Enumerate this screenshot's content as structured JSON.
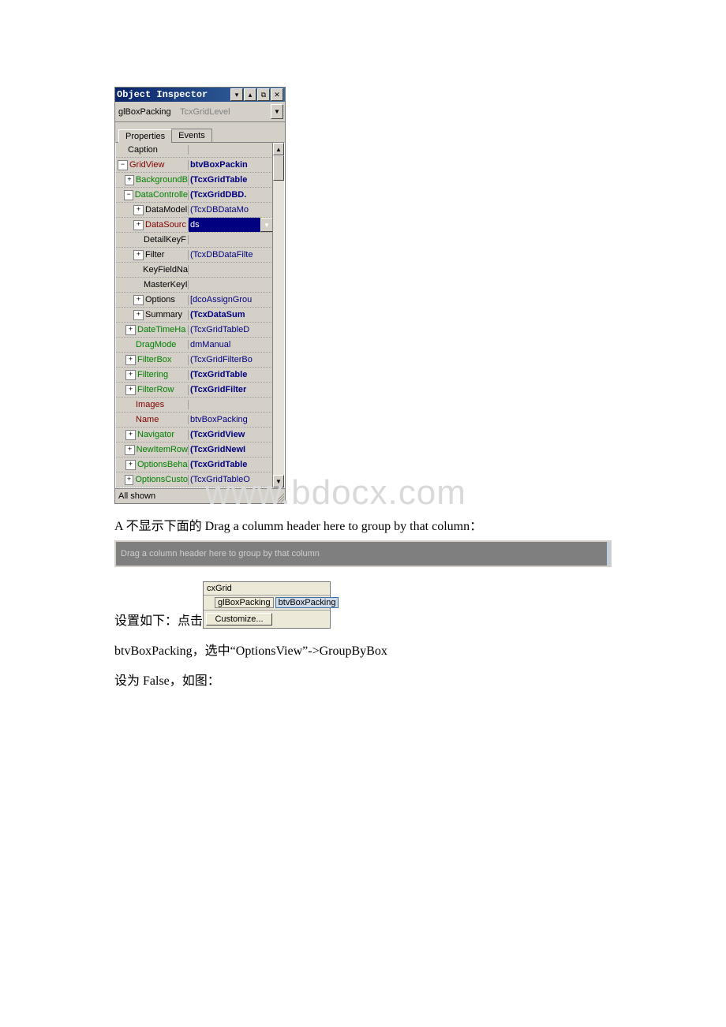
{
  "inspector": {
    "title": "Object Inspector",
    "combo": {
      "name": "glBoxPacking",
      "type": "TcxGridLevel"
    },
    "tabs": {
      "properties": "Properties",
      "events": "Events"
    },
    "rows": [
      {
        "indent": 0,
        "icon": "",
        "name": "Caption",
        "ncol": "black",
        "val": ""
      },
      {
        "indent": 0,
        "icon": "−",
        "name": "GridView",
        "ncol": "maroon",
        "val": "btvBoxPackin",
        "vcol": "navy"
      },
      {
        "indent": 1,
        "icon": "+",
        "name": "BackgroundB",
        "ncol": "green",
        "val": "(TcxGridTable",
        "vcol": "navy"
      },
      {
        "indent": 1,
        "icon": "−",
        "name": "DataControlle",
        "ncol": "green",
        "val": "(TcxGridDBD.",
        "vcol": "navy"
      },
      {
        "indent": 2,
        "icon": "+",
        "name": "DataModel",
        "ncol": "black",
        "val": "(TcxDBDataMo",
        "vcol": "navyn"
      },
      {
        "indent": 2,
        "icon": "+",
        "name": "DataSourc",
        "ncol": "maroon",
        "val": "ds",
        "vcol": "sel",
        "selected": true
      },
      {
        "indent": 2,
        "icon": "",
        "name": "DetailKeyF",
        "ncol": "black",
        "val": ""
      },
      {
        "indent": 2,
        "icon": "+",
        "name": "Filter",
        "ncol": "black",
        "val": "(TcxDBDataFilte",
        "vcol": "navyn"
      },
      {
        "indent": 2,
        "icon": "",
        "name": "KeyFieldNa",
        "ncol": "black",
        "val": ""
      },
      {
        "indent": 2,
        "icon": "",
        "name": "MasterKeyI",
        "ncol": "black",
        "val": ""
      },
      {
        "indent": 2,
        "icon": "+",
        "name": "Options",
        "ncol": "black",
        "val": "[dcoAssignGrou",
        "vcol": "navyn"
      },
      {
        "indent": 2,
        "icon": "+",
        "name": "Summary",
        "ncol": "black",
        "val": "(TcxDataSum",
        "vcol": "navy"
      },
      {
        "indent": 1,
        "icon": "+",
        "name": "DateTimeHa",
        "ncol": "green",
        "val": "(TcxGridTableD",
        "vcol": "navyn"
      },
      {
        "indent": 1,
        "icon": "",
        "name": "DragMode",
        "ncol": "green",
        "val": "dmManual",
        "vcol": "navyn"
      },
      {
        "indent": 1,
        "icon": "+",
        "name": "FilterBox",
        "ncol": "green",
        "val": "(TcxGridFilterBo",
        "vcol": "navyn"
      },
      {
        "indent": 1,
        "icon": "+",
        "name": "Filtering",
        "ncol": "green",
        "val": "(TcxGridTable",
        "vcol": "navy"
      },
      {
        "indent": 1,
        "icon": "+",
        "name": "FilterRow",
        "ncol": "green",
        "val": "(TcxGridFilter",
        "vcol": "navy"
      },
      {
        "indent": 1,
        "icon": "",
        "name": "Images",
        "ncol": "maroon",
        "val": ""
      },
      {
        "indent": 1,
        "icon": "",
        "name": "Name",
        "ncol": "maroon",
        "val": "btvBoxPacking",
        "vcol": "navyn"
      },
      {
        "indent": 1,
        "icon": "+",
        "name": "Navigator",
        "ncol": "green",
        "val": "(TcxGridView",
        "vcol": "navy"
      },
      {
        "indent": 1,
        "icon": "+",
        "name": "NewItemRow",
        "ncol": "green",
        "val": "(TcxGridNewI",
        "vcol": "navy"
      },
      {
        "indent": 1,
        "icon": "+",
        "name": "OptionsBeha",
        "ncol": "green",
        "val": "(TcxGridTable",
        "vcol": "navy"
      },
      {
        "indent": 1,
        "icon": "+",
        "name": "OptionsCusto",
        "ncol": "green",
        "val": "(TcxGridTableO",
        "vcol": "navyn"
      }
    ],
    "status": "All shown"
  },
  "watermark": "www.bdocx.com",
  "text": {
    "line_a": "A 不显示下面的 Drag a columm header here to group by that column：",
    "greybar": "Drag a column header here to group by that column",
    "pre_cx": "设置如下：点击",
    "para2": " btvBoxPacking，选中“OptionsView”->GroupByBox",
    "para3": "设为 False，如图："
  },
  "cxbox": {
    "title": "cxGrid",
    "chip1": "glBoxPacking",
    "chip2": "btvBoxPacking",
    "button": "Customize..."
  }
}
